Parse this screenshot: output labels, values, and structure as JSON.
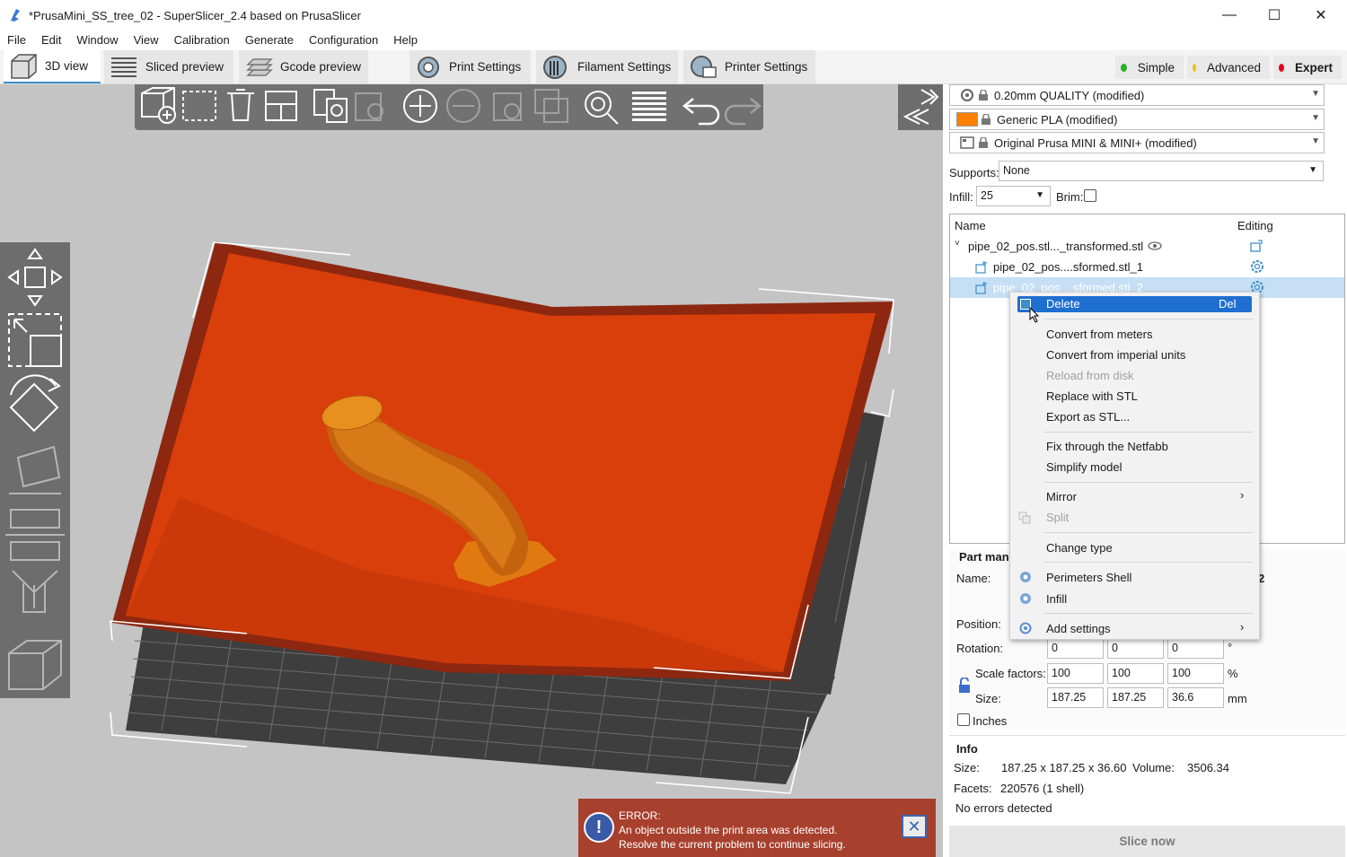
{
  "window": {
    "title": "*PrusaMini_SS_tree_02 - SuperSlicer_2.4  based on PrusaSlicer",
    "minimize": "—",
    "maximize": "☐",
    "close": "✕"
  },
  "menu": [
    "File",
    "Edit",
    "Window",
    "View",
    "Calibration",
    "Generate",
    "Configuration",
    "Help"
  ],
  "tabs": {
    "view3d": "3D view",
    "sliced": "Sliced preview",
    "gcode": "Gcode preview",
    "print": "Print Settings",
    "filament": "Filament Settings",
    "printer": "Printer Settings"
  },
  "modes": {
    "simple": "Simple",
    "advanced": "Advanced",
    "expert": "Expert",
    "colors": {
      "simple": "#27b327",
      "advanced": "#e8c416",
      "expert": "#e3001b"
    }
  },
  "presets": {
    "print": "0.20mm QUALITY (modified)",
    "filament": "Generic PLA (modified)",
    "filament_color": "#ff8000",
    "printer": "Original Prusa MINI & MINI+ (modified)"
  },
  "quick": {
    "supports_label": "Supports:",
    "supports_value": "None",
    "infill_label": "Infill:",
    "infill_value": "25",
    "brim_label": "Brim:"
  },
  "object_list": {
    "col_name": "Name",
    "col_editing": "Editing",
    "rows": [
      "pipe_02_pos.stl..._transformed.stl",
      "pipe_02_pos....sformed.stl_1",
      "pipe_02_pos....sformed.stl_2"
    ]
  },
  "context_menu": {
    "delete": "Delete",
    "delete_shortcut": "Del",
    "convert_meters": "Convert from meters",
    "convert_imperial": "Convert from imperial units",
    "reload": "Reload from disk",
    "replace": "Replace with STL",
    "export": "Export as STL...",
    "netfabb": "Fix through the Netfabb",
    "simplify": "Simplify model",
    "mirror": "Mirror",
    "split": "Split",
    "change_type": "Change type",
    "perimeters": "Perimeters  Shell",
    "infill": "Infill",
    "add_settings": "Add settings",
    "submenu_arrow": "›"
  },
  "part_manipulation": {
    "header": "Part man",
    "name_label": "Name:",
    "name_tail": "2",
    "position_label": "Position:",
    "rotation_label": "Rotation:",
    "rotation": [
      "0",
      "0",
      "0"
    ],
    "rotation_unit": "°",
    "scale_label": "Scale factors:",
    "scale": [
      "100",
      "100",
      "100"
    ],
    "scale_unit": "%",
    "size_label": "Size:",
    "size": [
      "187.25",
      "187.25",
      "36.6"
    ],
    "size_unit": "mm",
    "inches_label": "Inches"
  },
  "info": {
    "header": "Info",
    "size_label": "Size:",
    "size_value": "187.25 x 187.25 x 36.60",
    "volume_label": "Volume:",
    "volume_value": "3506.34",
    "facets_label": "Facets:",
    "facets_value": "220576 (1 shell)",
    "status": "No errors detected"
  },
  "error": {
    "icon": "!",
    "line1": "ERROR:",
    "line2": "An object outside the print area was detected.",
    "line3": "Resolve the current problem to continue slicing.",
    "close": "✕"
  },
  "slice_button": "Slice now"
}
